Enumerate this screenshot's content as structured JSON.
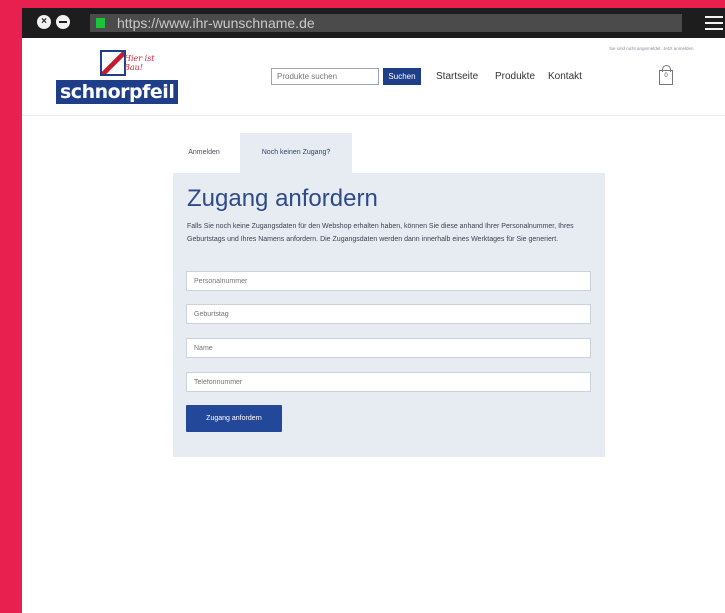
{
  "browser": {
    "url": "https://www.ihr-wunschname.de",
    "close_glyph": "×"
  },
  "header": {
    "logo_text": "schnorpfeil",
    "logo_slogan": "Hier ist Bau!",
    "search_placeholder": "Produkte suchen",
    "search_button": "Suchen",
    "nav": [
      "Startseite",
      "Produkte",
      "Kontakt"
    ],
    "account_note": "Sie sind nicht angemeldet. Jetzt anmelden",
    "cart_count": "0"
  },
  "tabs": [
    "Anmelden",
    "Noch keinen Zugang?"
  ],
  "form": {
    "title": "Zugang anfordern",
    "description": "Falls Sie noch keine Zugangsdaten für den Webshop erhalten haben, können Sie diese anhand Ihrer Personalnummer, Ihres Geburtstags und Ihres Namens anfordern. Die Zugangsdaten werden dann innerhalb eines Werktages für Sie generiert.",
    "fields": [
      "Personalnummer",
      "Geburtstag",
      "Name",
      "Telefonnummer"
    ],
    "submit": "Zugang anfordern"
  },
  "colors": {
    "frame": "#e8204f",
    "brand_blue": "#1f3e8a",
    "panel_bg": "#e6ecf2",
    "secure_green": "#19c43b"
  }
}
